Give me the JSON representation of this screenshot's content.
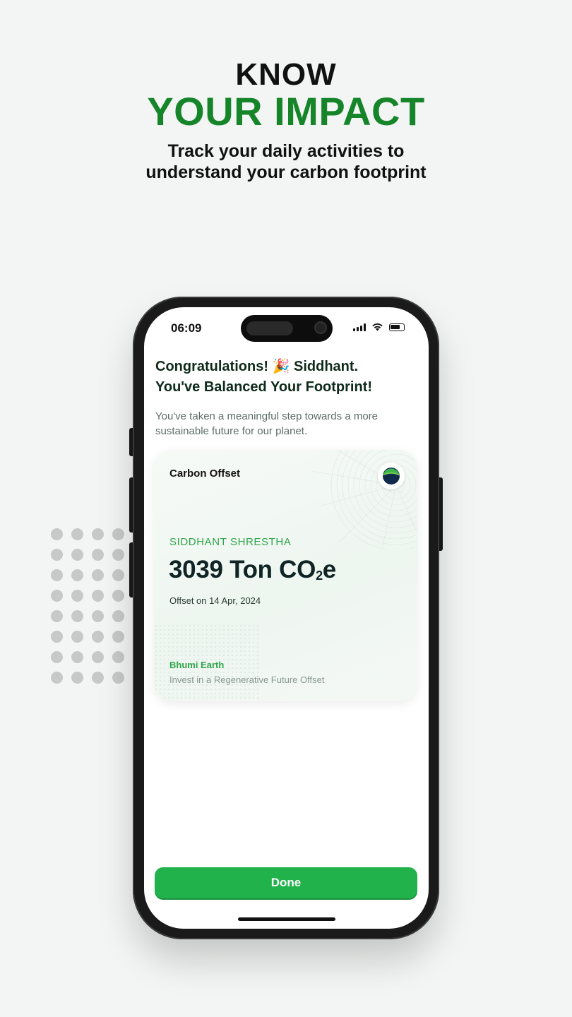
{
  "hero": {
    "line1": "KNOW",
    "line2": "YOUR IMPACT",
    "subtitle_line1": "Track your daily activities to",
    "subtitle_line2": "understand your carbon footprint"
  },
  "status_bar": {
    "time": "06:09",
    "icons": [
      "signal-icon",
      "wifi-icon",
      "battery-icon"
    ]
  },
  "screen": {
    "headline_line1": "Congratulations! 🎉 Siddhant.",
    "headline_line2": "You've Balanced Your Footprint!",
    "description": "You've taken a meaningful step towards a more sustainable future for our planet."
  },
  "card": {
    "title": "Carbon Offset",
    "name": "SIDDHANT SHRESTHA",
    "amount_value": "3039 Ton CO",
    "amount_sub": "2",
    "amount_suffix": "e",
    "date": "Offset on 14 Apr, 2024",
    "brand": "Bhumi Earth",
    "tagline": "Invest in a Regenerative Future Offset"
  },
  "actions": {
    "done_label": "Done"
  },
  "colors": {
    "brand_green": "#16852a",
    "button_green": "#22b24c",
    "accent_green": "#2fa54a"
  }
}
